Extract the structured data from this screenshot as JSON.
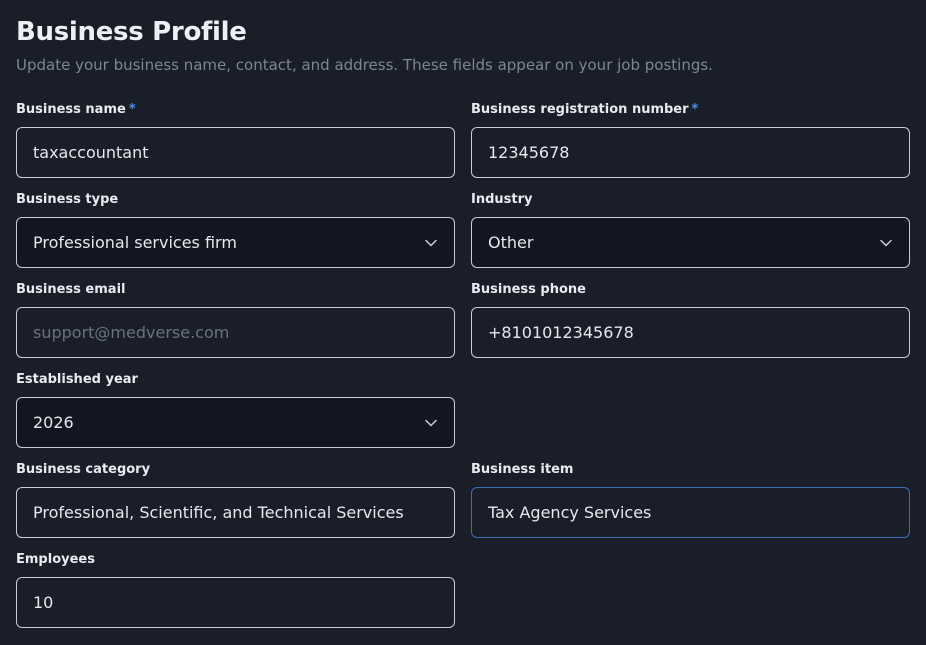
{
  "header": {
    "title": "Business Profile",
    "subtitle": "Update your business name, contact, and address. These fields appear on your job postings."
  },
  "required_mark": "*",
  "fields": {
    "business_name": {
      "label": "Business name",
      "value": "taxaccountant"
    },
    "registration_number": {
      "label": "Business registration number",
      "value": "12345678"
    },
    "business_type": {
      "label": "Business type",
      "value": "Professional services firm"
    },
    "industry": {
      "label": "Industry",
      "value": "Other"
    },
    "business_email": {
      "label": "Business email",
      "value": "",
      "placeholder": "support@medverse.com"
    },
    "business_phone": {
      "label": "Business phone",
      "value": "+8101012345678"
    },
    "established_year": {
      "label": "Established year",
      "value": "2026"
    },
    "business_category": {
      "label": "Business category",
      "value": "Professional, Scientific, and Technical Services"
    },
    "business_item": {
      "label": "Business item",
      "value": "Tax Agency Services"
    },
    "employees": {
      "label": "Employees",
      "value": "10"
    }
  },
  "colors": {
    "background": "#1a1e29",
    "required_accent": "#4f8fe8",
    "focus_border": "#3b6fb3"
  },
  "icons": {
    "select_chevron": "chevron-down-icon"
  }
}
